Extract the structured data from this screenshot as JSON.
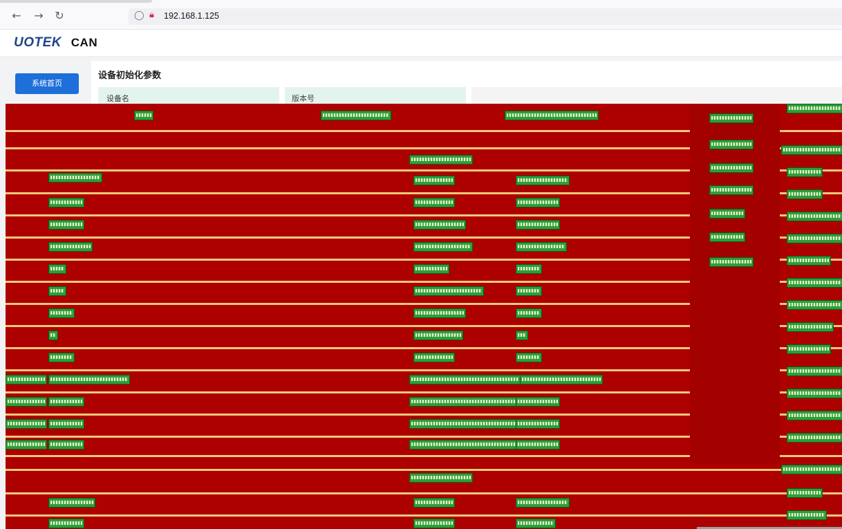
{
  "browser": {
    "back_icon": "arrow-left-icon",
    "forward_icon": "arrow-right-icon",
    "reload_icon": "reload-icon",
    "shield_icon": "shield-icon",
    "lock_icon": "lock-icon",
    "url": "192.168.1.125"
  },
  "header": {
    "brand": "UOTEK",
    "product": "CAN"
  },
  "sidebar": {
    "items": [
      {
        "label": "系统首页"
      }
    ]
  },
  "main": {
    "title": "设备初始化参数",
    "cards": [
      {
        "label": "设备名"
      },
      {
        "label": "版本号"
      }
    ]
  },
  "colors": {
    "accent": "#1e6fd9",
    "glitch_bg": "#ad0000",
    "glitch_line": "#f7c97c",
    "card_bg": "#e3f4ec"
  }
}
